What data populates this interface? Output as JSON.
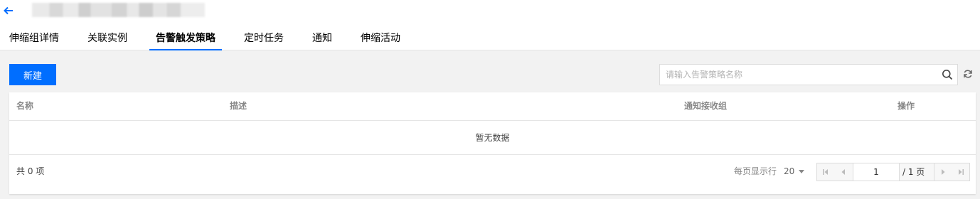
{
  "header": {
    "tabs": [
      {
        "label": "伸缩组详情",
        "active": false
      },
      {
        "label": "关联实例",
        "active": false
      },
      {
        "label": "告警触发策略",
        "active": true
      },
      {
        "label": "定时任务",
        "active": false
      },
      {
        "label": "通知",
        "active": false
      },
      {
        "label": "伸缩活动",
        "active": false
      }
    ]
  },
  "toolbar": {
    "new_label": "新建",
    "search_placeholder": "请输入告警策略名称"
  },
  "table": {
    "columns": [
      "名称",
      "描述",
      "通知接收组",
      "操作"
    ],
    "empty_text": "暂无数据"
  },
  "pagination": {
    "total_text": "共 0 项",
    "per_page_label": "每页显示行",
    "per_page_value": "20",
    "current_page": "1",
    "total_pages_text": "/ 1 页"
  },
  "colors": {
    "accent": "#006eff",
    "background": "#f2f2f2"
  },
  "icons": [
    "back-arrow-icon",
    "search-icon",
    "refresh-icon",
    "first-page-icon",
    "prev-page-icon",
    "next-page-icon",
    "last-page-icon"
  ]
}
